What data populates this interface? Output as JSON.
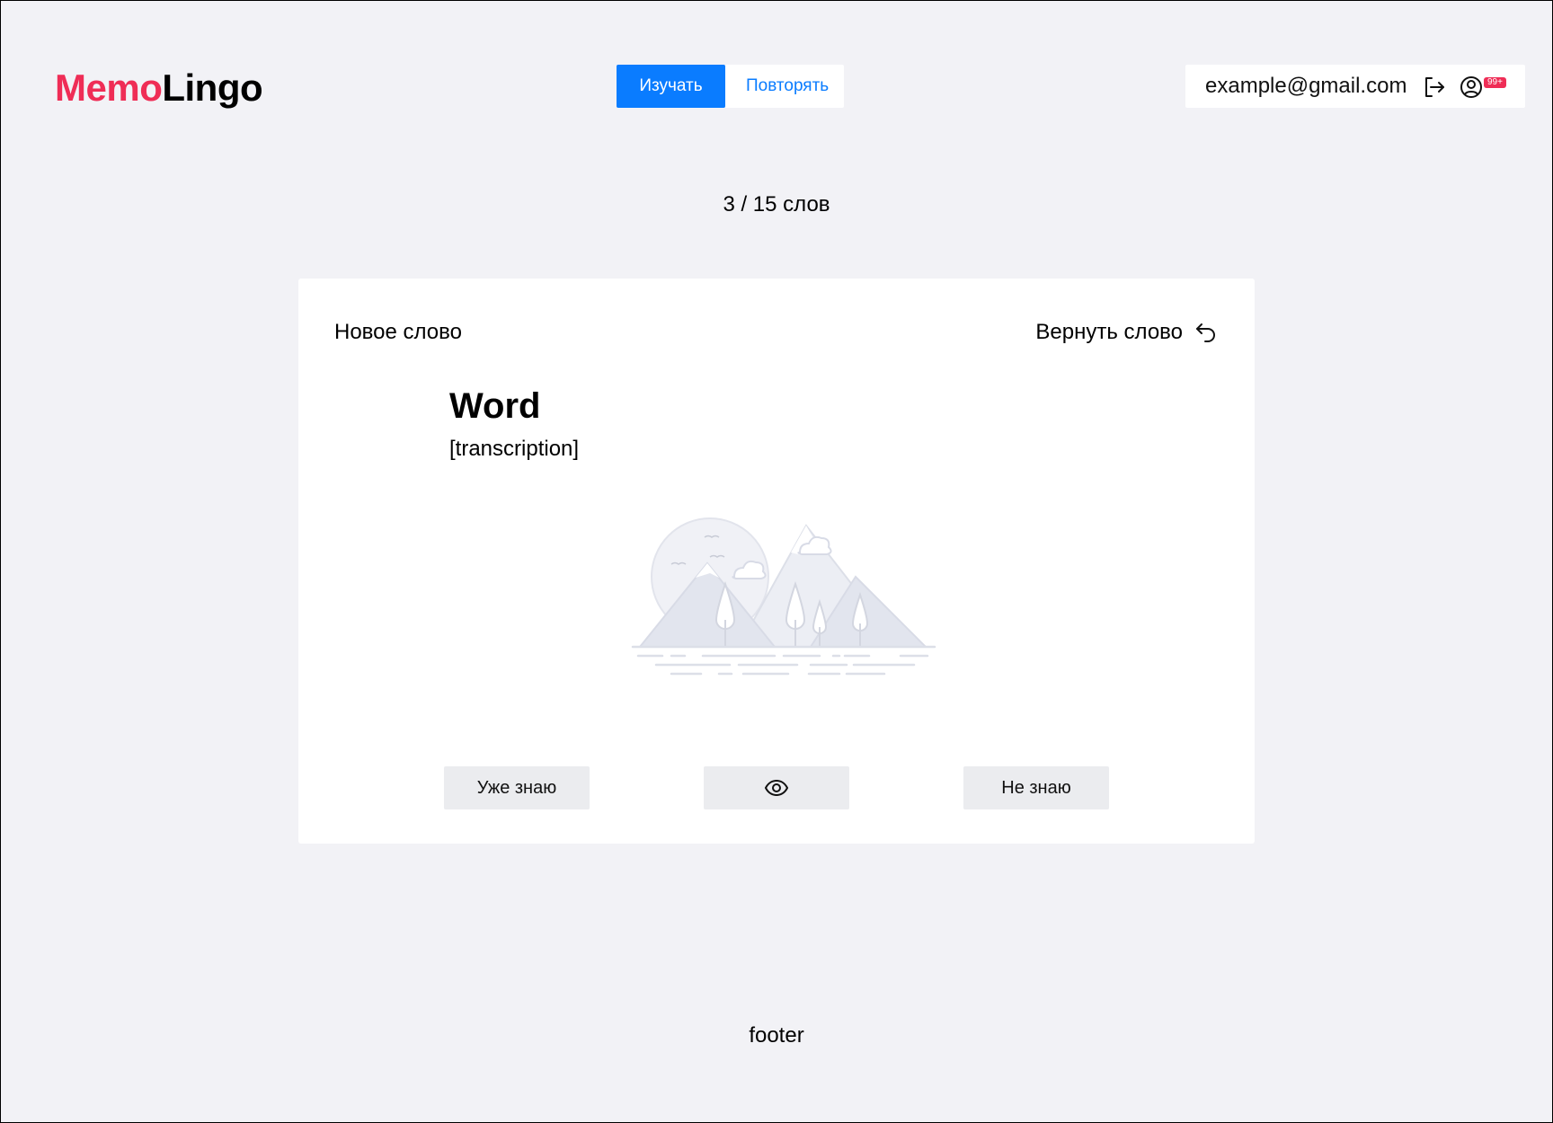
{
  "app": {
    "logo_part1": "Memo",
    "logo_part2": "Lingo",
    "brand_color": "#ef2d56",
    "accent_color": "#0a7cff"
  },
  "nav": {
    "tabs": [
      {
        "label": "Изучать",
        "active": true
      },
      {
        "label": "Повторять",
        "active": false
      }
    ]
  },
  "account": {
    "email": "example@gmail.com",
    "logout_icon": "logout-icon",
    "profile_icon": "user-circle-icon",
    "notification_badge": "99+"
  },
  "progress": {
    "text": "3 / 15 слов"
  },
  "card": {
    "label": "Новое слово",
    "return_label": "Вернуть слово",
    "return_icon": "undo-arrow-icon",
    "word": "Word",
    "transcription": "[transcription]",
    "image_icon": "image-placeholder-icon",
    "buttons": {
      "know": "Уже знаю",
      "show_icon": "eye-icon",
      "dont_know": "Не знаю"
    }
  },
  "footer": {
    "text": "footer"
  }
}
